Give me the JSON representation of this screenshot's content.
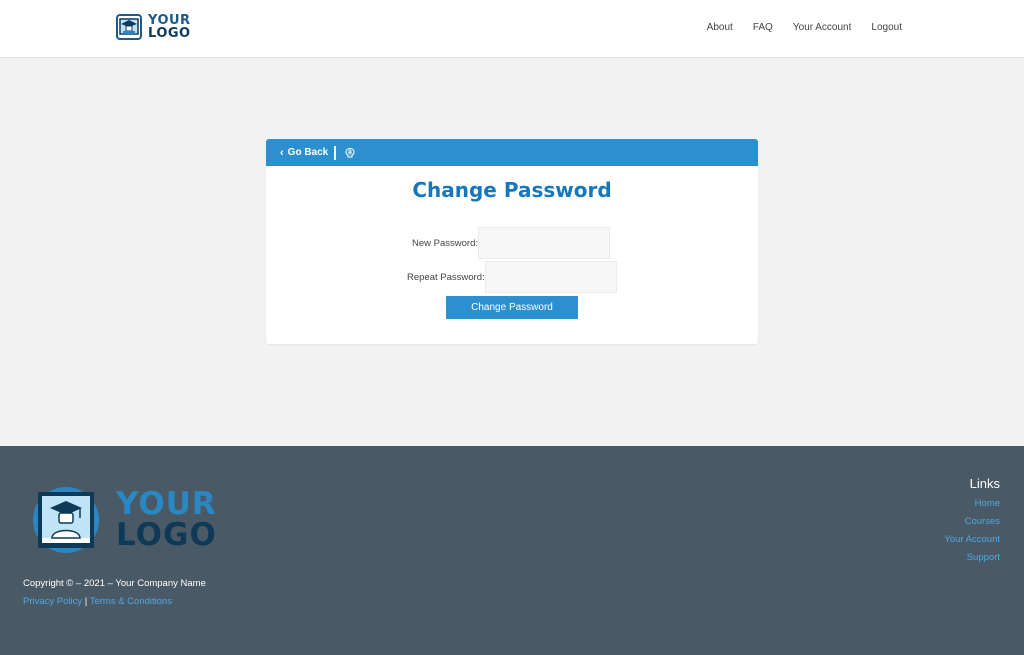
{
  "header": {
    "logo_line1": "YOUR",
    "logo_line2": "LOGO",
    "nav": [
      "About",
      "FAQ",
      "Your Account",
      "Logout"
    ]
  },
  "card": {
    "go_back_label": "Go Back",
    "title": "Change Password",
    "new_password_label": "New Password:",
    "repeat_password_label": "Repeat Password:",
    "new_password_value": "",
    "repeat_password_value": "",
    "submit_label": "Change Password",
    "icons": [
      "chevron-left-icon",
      "brain-icon"
    ]
  },
  "footer": {
    "logo_line1": "YOUR",
    "logo_line2": "LOGO",
    "copyright": "Copyright © – 2021 – Your Company Name",
    "privacy_label": "Privacy Policy",
    "separator": "|",
    "terms_label": "Terms & Conditions",
    "links_title": "Links",
    "links": [
      "Home",
      "Courses",
      "Your Account",
      "Support"
    ]
  },
  "colors": {
    "accent": "#2b8fd0",
    "title": "#1777bd",
    "footer_bg": "#4a5966",
    "footer_link": "#4da9e6"
  }
}
